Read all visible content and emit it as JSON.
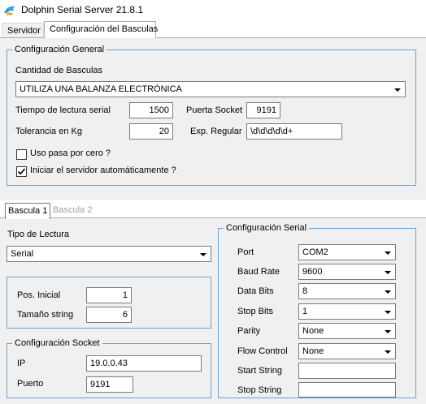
{
  "window": {
    "title": "Dolphin Serial Server 21.8.1"
  },
  "tabs": [
    {
      "label": "Servidor"
    },
    {
      "label": "Configuración del Basculas"
    }
  ],
  "general": {
    "group_title": "Configuración General",
    "cantidad_label": "Cantidad de Basculas",
    "cantidad_value": "UTILIZA UNA BALANZA ELECTRÓNICA",
    "tiempo_label": "Tiempo de lectura serial",
    "tiempo_value": "1500",
    "puerta_label": "Puerta Socket",
    "puerta_value": "9191",
    "tolerancia_label": "Tolerancia en Kg",
    "tolerancia_value": "20",
    "regex_label": "Exp. Regular",
    "regex_value": "\\d\\d\\d\\d\\d+",
    "pasa_cero_label": "Uso pasa por cero ?",
    "pasa_cero_checked": false,
    "autostart_label": "Iniciar el servidor automáticamente ?",
    "autostart_checked": true
  },
  "bascula_tabs": [
    {
      "label": "Bascula 1"
    },
    {
      "label": "Bascula 2"
    }
  ],
  "lectura": {
    "tipo_label": "Tipo de Lectura",
    "tipo_value": "Serial",
    "pos_label": "Pos. Inicial",
    "pos_value": "1",
    "tamano_label": "Tamaño string",
    "tamano_value": "6"
  },
  "socket": {
    "group_title": "Configuración Socket",
    "ip_label": "IP",
    "ip_value": "19.0.0.43",
    "puerto_label": "Puerto",
    "puerto_value": "9191"
  },
  "serial": {
    "group_title": "Configuración Serial",
    "port_label": "Port",
    "port_value": "COM2",
    "baud_label": "Baud Rate",
    "baud_value": "9600",
    "databits_label": "Data Bits",
    "databits_value": "8",
    "stopbits_label": "Stop Bits",
    "stopbits_value": "1",
    "parity_label": "Parity",
    "parity_value": "None",
    "flow_label": "Flow Control",
    "flow_value": "None",
    "start_label": "Start String",
    "start_value": "",
    "stop_label": "Stop String",
    "stop_value": ""
  },
  "colors": {
    "group_border": "#6ca0cc",
    "panel_bg": "#f0f0f0"
  }
}
